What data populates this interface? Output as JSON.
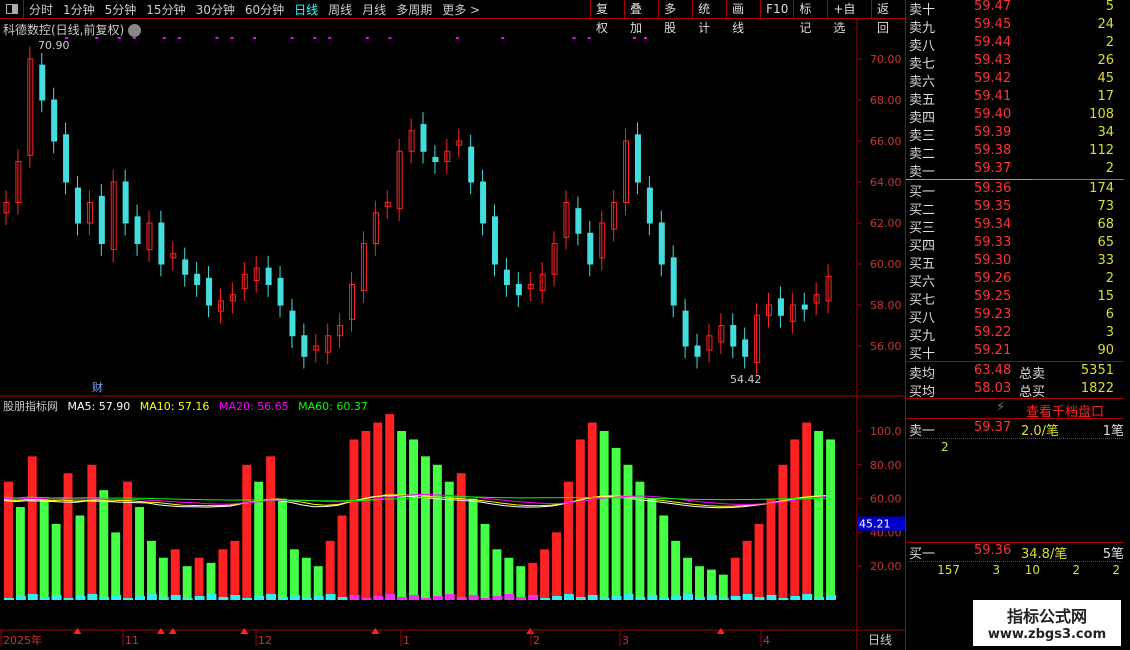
{
  "toolbar": {
    "periods": [
      "分时",
      "1分钟",
      "5分钟",
      "15分钟",
      "30分钟",
      "60分钟",
      "日线",
      "周线",
      "月线",
      "多周期",
      "更多 >"
    ],
    "active_period": "日线",
    "tools": [
      "复权",
      "叠加",
      "多股",
      "统计",
      "画线",
      "F10",
      "标记",
      "+自选",
      "返回"
    ]
  },
  "chart": {
    "title": "科德数控(日线,前复权)",
    "high_label": "70.90",
    "low_label": "54.42",
    "cai_marker": "财",
    "price_ticks": [
      "70.00",
      "68.00",
      "66.00",
      "64.00",
      "62.00",
      "60.00",
      "58.00",
      "56.00"
    ]
  },
  "indicator": {
    "name": "股朋指标网",
    "ma5": "MA5: 57.90",
    "ma10": "MA10: 57.16",
    "ma20": "MA20: 56.65",
    "ma60": "MA60: 60.37",
    "ticks": [
      "100.0",
      "80.00",
      "60.00",
      "40.00",
      "20.00"
    ],
    "current": "45.21"
  },
  "time_axis": {
    "labels": [
      "2025年",
      "11",
      "12",
      "1",
      "2",
      "3",
      "4"
    ],
    "period": "日线"
  },
  "colors": {
    "up": "#ff2222",
    "down": "#44ff44",
    "candle_down": "#44dddd",
    "ma5": "#ffffff",
    "ma10": "#ffff00",
    "ma20": "#ff00ff",
    "ma60": "#00ff00"
  },
  "chart_data": {
    "type": "candlestick",
    "ylim": [
      54,
      72
    ],
    "closes": [
      63,
      65,
      70,
      68,
      66,
      64,
      62,
      63,
      61,
      64,
      62,
      61,
      62,
      60,
      60.5,
      59.5,
      59,
      58,
      58.2,
      58.5,
      59.5,
      59.8,
      59,
      58,
      56.5,
      55.5,
      56,
      56.5,
      57,
      59,
      61,
      62.5,
      63,
      65.5,
      66.5,
      65.5,
      65,
      65.5,
      66,
      64,
      62,
      60,
      59,
      58.5,
      59,
      59.5,
      61,
      63,
      61.5,
      60,
      62,
      63,
      66,
      64,
      62,
      60,
      58,
      56,
      55.5,
      56.5,
      57,
      56,
      55.5,
      57.5,
      58,
      57.5,
      58,
      57.8,
      58.5,
      59.4
    ],
    "indicator_values": [
      70,
      55,
      85,
      60,
      45,
      75,
      50,
      80,
      65,
      40,
      70,
      55,
      35,
      25,
      30,
      20,
      25,
      22,
      30,
      35,
      80,
      70,
      85,
      60,
      30,
      25,
      20,
      35,
      50,
      95,
      100,
      105,
      110,
      100,
      95,
      85,
      80,
      70,
      75,
      60,
      45,
      30,
      25,
      20,
      22,
      30,
      40,
      70,
      95,
      105,
      100,
      90,
      80,
      70,
      60,
      50,
      35,
      25,
      20,
      18,
      15,
      25,
      35,
      45,
      60,
      80,
      95,
      105,
      100,
      95
    ]
  },
  "order_book": {
    "asks": [
      {
        "l": "卖十",
        "p": "59.47",
        "v": "5"
      },
      {
        "l": "卖九",
        "p": "59.45",
        "v": "24"
      },
      {
        "l": "卖八",
        "p": "59.44",
        "v": "2"
      },
      {
        "l": "卖七",
        "p": "59.43",
        "v": "26"
      },
      {
        "l": "卖六",
        "p": "59.42",
        "v": "45"
      },
      {
        "l": "卖五",
        "p": "59.41",
        "v": "17"
      },
      {
        "l": "卖四",
        "p": "59.40",
        "v": "108"
      },
      {
        "l": "卖三",
        "p": "59.39",
        "v": "34"
      },
      {
        "l": "卖二",
        "p": "59.38",
        "v": "112"
      },
      {
        "l": "卖一",
        "p": "59.37",
        "v": "2"
      }
    ],
    "bids": [
      {
        "l": "买一",
        "p": "59.36",
        "v": "174"
      },
      {
        "l": "买二",
        "p": "59.35",
        "v": "73"
      },
      {
        "l": "买三",
        "p": "59.34",
        "v": "68"
      },
      {
        "l": "买四",
        "p": "59.33",
        "v": "65"
      },
      {
        "l": "买五",
        "p": "59.30",
        "v": "33"
      },
      {
        "l": "买六",
        "p": "59.26",
        "v": "2"
      },
      {
        "l": "买七",
        "p": "59.25",
        "v": "15"
      },
      {
        "l": "买八",
        "p": "59.23",
        "v": "6"
      },
      {
        "l": "买九",
        "p": "59.22",
        "v": "3"
      },
      {
        "l": "买十",
        "p": "59.21",
        "v": "90"
      }
    ],
    "ask_avg_label": "卖均",
    "ask_avg": "63.48",
    "total_ask_label": "总卖",
    "total_ask": "5351",
    "bid_avg_label": "买均",
    "bid_avg": "58.03",
    "total_bid_label": "总买",
    "total_bid": "1822"
  },
  "queue": {
    "view_label": "查看千档盘口",
    "sell1_label": "卖一",
    "sell1_price": "59.37",
    "sell1_avg": "2.0/笔",
    "sell1_count": "1笔",
    "sell1_orders": [
      "2"
    ],
    "buy1_label": "买一",
    "buy1_price": "59.36",
    "buy1_avg": "34.8/笔",
    "buy1_count": "5笔",
    "buy1_orders": [
      "157",
      "3",
      "10",
      "2",
      "2"
    ]
  },
  "watermark": {
    "line1": "指标公式网",
    "line2": "www.zbgs3.com"
  }
}
